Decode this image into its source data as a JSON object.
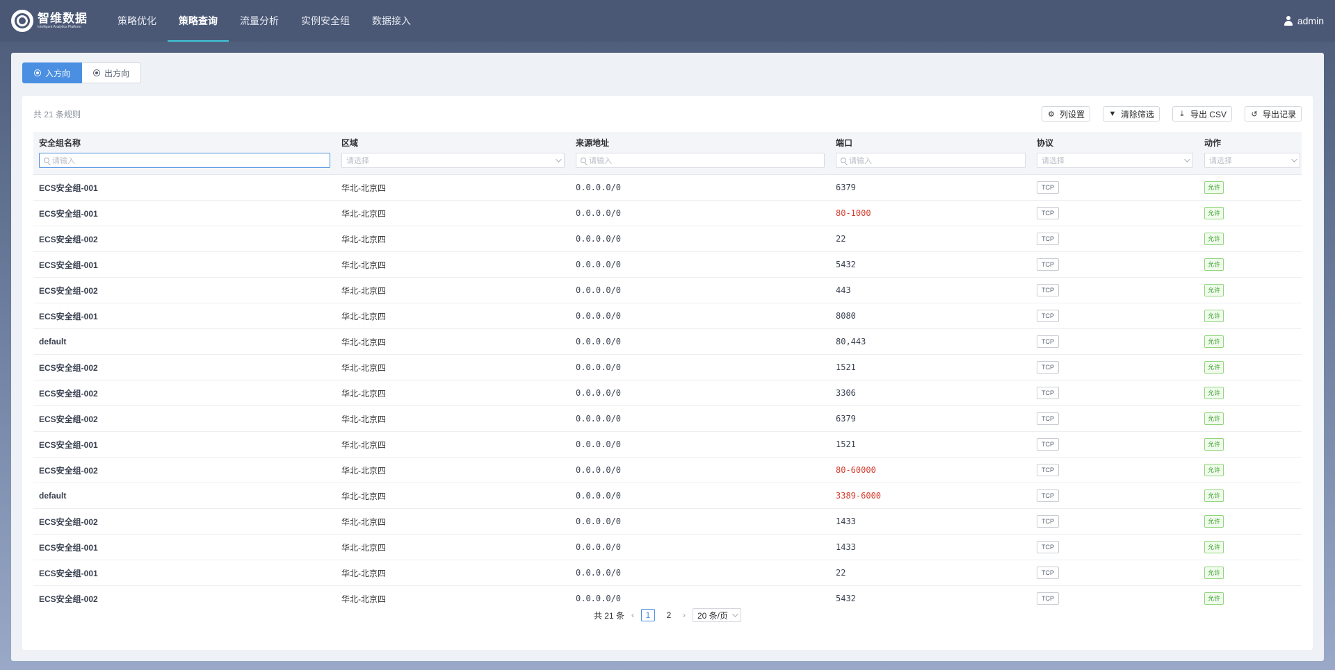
{
  "app": {
    "logo_name": "智维数据",
    "logo_sub": "Intelligent Analytics Platform",
    "user": "admin"
  },
  "nav": [
    {
      "label": "策略优化",
      "active": false
    },
    {
      "label": "策略查询",
      "active": true
    },
    {
      "label": "流量分析",
      "active": false
    },
    {
      "label": "实例安全组",
      "active": false
    },
    {
      "label": "数据接入",
      "active": false
    }
  ],
  "direction": {
    "inbound": "入方向",
    "outbound": "出方向",
    "selected": "inbound"
  },
  "toolbar": {
    "total": "共 21 条规则",
    "columns": "列设置",
    "clear_filter": "清除筛选",
    "export_csv": "导出 CSV",
    "export_log": "导出记录"
  },
  "columns": [
    {
      "label": "安全组名称",
      "filter": "请输入",
      "type": "input"
    },
    {
      "label": "区域",
      "filter": "请选择",
      "type": "select"
    },
    {
      "label": "来源地址",
      "filter": "请输入",
      "type": "input"
    },
    {
      "label": "端口",
      "filter": "请输入",
      "type": "input"
    },
    {
      "label": "协议",
      "filter": "请选择",
      "type": "select"
    },
    {
      "label": "动作",
      "filter": "请选择",
      "type": "select"
    }
  ],
  "rows": [
    {
      "name": "ECS安全组-001",
      "region": "华北-北京四",
      "source": "0.0.0.0/0",
      "port": "6379",
      "port_warn": false,
      "protocol": "TCP",
      "action": "允许"
    },
    {
      "name": "ECS安全组-001",
      "region": "华北-北京四",
      "source": "0.0.0.0/0",
      "port": "80-1000",
      "port_warn": true,
      "protocol": "TCP",
      "action": "允许"
    },
    {
      "name": "ECS安全组-002",
      "region": "华北-北京四",
      "source": "0.0.0.0/0",
      "port": "22",
      "port_warn": false,
      "protocol": "TCP",
      "action": "允许"
    },
    {
      "name": "ECS安全组-001",
      "region": "华北-北京四",
      "source": "0.0.0.0/0",
      "port": "5432",
      "port_warn": false,
      "protocol": "TCP",
      "action": "允许"
    },
    {
      "name": "ECS安全组-002",
      "region": "华北-北京四",
      "source": "0.0.0.0/0",
      "port": "443",
      "port_warn": false,
      "protocol": "TCP",
      "action": "允许"
    },
    {
      "name": "ECS安全组-001",
      "region": "华北-北京四",
      "source": "0.0.0.0/0",
      "port": "8080",
      "port_warn": false,
      "protocol": "TCP",
      "action": "允许"
    },
    {
      "name": "default",
      "region": "华北-北京四",
      "source": "0.0.0.0/0",
      "port": "80,443",
      "port_warn": false,
      "protocol": "TCP",
      "action": "允许"
    },
    {
      "name": "ECS安全组-002",
      "region": "华北-北京四",
      "source": "0.0.0.0/0",
      "port": "1521",
      "port_warn": false,
      "protocol": "TCP",
      "action": "允许"
    },
    {
      "name": "ECS安全组-002",
      "region": "华北-北京四",
      "source": "0.0.0.0/0",
      "port": "3306",
      "port_warn": false,
      "protocol": "TCP",
      "action": "允许"
    },
    {
      "name": "ECS安全组-002",
      "region": "华北-北京四",
      "source": "0.0.0.0/0",
      "port": "6379",
      "port_warn": false,
      "protocol": "TCP",
      "action": "允许"
    },
    {
      "name": "ECS安全组-001",
      "region": "华北-北京四",
      "source": "0.0.0.0/0",
      "port": "1521",
      "port_warn": false,
      "protocol": "TCP",
      "action": "允许"
    },
    {
      "name": "ECS安全组-002",
      "region": "华北-北京四",
      "source": "0.0.0.0/0",
      "port": "80-60000",
      "port_warn": true,
      "protocol": "TCP",
      "action": "允许"
    },
    {
      "name": "default",
      "region": "华北-北京四",
      "source": "0.0.0.0/0",
      "port": "3389-6000",
      "port_warn": true,
      "protocol": "TCP",
      "action": "允许"
    },
    {
      "name": "ECS安全组-002",
      "region": "华北-北京四",
      "source": "0.0.0.0/0",
      "port": "1433",
      "port_warn": false,
      "protocol": "TCP",
      "action": "允许"
    },
    {
      "name": "ECS安全组-001",
      "region": "华北-北京四",
      "source": "0.0.0.0/0",
      "port": "1433",
      "port_warn": false,
      "protocol": "TCP",
      "action": "允许"
    },
    {
      "name": "ECS安全组-001",
      "region": "华北-北京四",
      "source": "0.0.0.0/0",
      "port": "22",
      "port_warn": false,
      "protocol": "TCP",
      "action": "允许"
    },
    {
      "name": "ECS安全组-002",
      "region": "华北-北京四",
      "source": "0.0.0.0/0",
      "port": "5432",
      "port_warn": false,
      "protocol": "TCP",
      "action": "允许"
    }
  ],
  "pagination": {
    "total": "共 21 条",
    "prev": "‹",
    "next": "›",
    "pages": [
      "1",
      "2"
    ],
    "current": "1",
    "page_size": "20 条/页"
  },
  "colors": {
    "accent": "#4a8fe2",
    "nav_bg": "#4a5876",
    "nav_indicator": "#3fc8d8",
    "warn_port": "#d43a2b",
    "allow_tag": "#3aa12a"
  },
  "icons": {
    "columns": "gear-icon",
    "clear_filter": "filter-icon",
    "export_csv": "download-icon",
    "export_log": "history-icon"
  }
}
